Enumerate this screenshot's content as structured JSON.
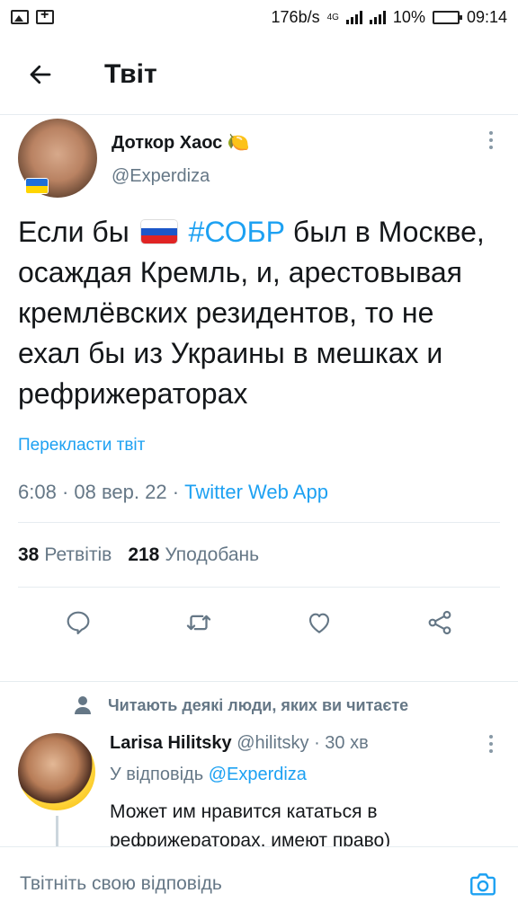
{
  "statusbar": {
    "speed": "176b/s",
    "network": "4G",
    "battery": "10%",
    "time": "09:14"
  },
  "header": {
    "title": "Твіт"
  },
  "tweet": {
    "author_name": "Доткор Хаос 🍋",
    "author_handle": "@Experdiza",
    "text_part1": "Если бы",
    "flag_emoji": "russia-flag",
    "hashtag": "#СОБР",
    "text_part2": " был в Москве, осаждая Кремль, и, арестовывая кремлёвских резидентов, то не ехал бы из Украины в мешках и рефрижераторах",
    "translate": "Перекласти твіт",
    "time": "6:08",
    "date": "08 вер. 22",
    "source": "Twitter Web App",
    "retweets_count": "38",
    "retweets_label": "Ретвітів",
    "likes_count": "218",
    "likes_label": "Уподобань"
  },
  "social_context": "Читають деякі люди, яких ви читаєте",
  "reply": {
    "name": "Larisa Hilitsky",
    "handle": "@hilitsky",
    "time": "30 хв",
    "reply_to_label": "У відповідь",
    "reply_to_handle": "@Experdiza",
    "text": "Может им нравится кататься в рефрижераторах, имеют право)"
  },
  "compose": {
    "placeholder": "Твітніть свою відповідь"
  },
  "colors": {
    "accent": "#1da1f2",
    "muted": "#657786",
    "border": "#e6ecf0"
  }
}
